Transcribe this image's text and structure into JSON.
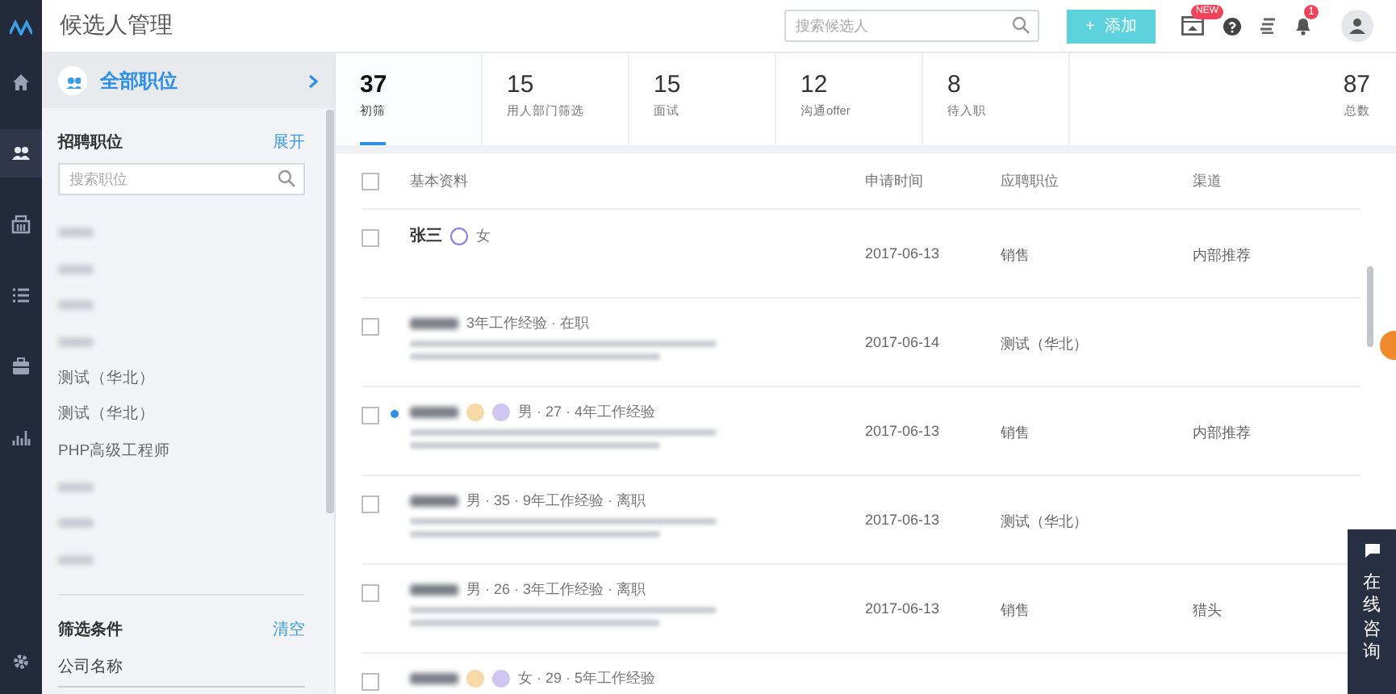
{
  "header": {
    "title": "候选人管理",
    "search": {
      "placeholder": "搜索候选人"
    },
    "add_button": {
      "icon": "+",
      "label": "添加"
    },
    "new_badge": "NEW",
    "notification_count": "1"
  },
  "nav": [
    {
      "kind": "home",
      "selected": false
    },
    {
      "kind": "people",
      "selected": true
    },
    {
      "kind": "building",
      "selected": false
    },
    {
      "kind": "list",
      "selected": false
    },
    {
      "kind": "case",
      "selected": false
    },
    {
      "kind": "chart",
      "selected": false
    }
  ],
  "sidebar": {
    "all_jobs": "全部职位",
    "section": "招聘职位",
    "expand": "展开",
    "search": {
      "placeholder": "搜索职位"
    },
    "jobs": [
      {
        "blurred": true
      },
      {
        "blurred": true
      },
      {
        "blurred": true
      },
      {
        "blurred": true
      },
      {
        "label": "测试（华北）",
        "blurred": false
      },
      {
        "label": "测试（华北）",
        "blurred": false
      },
      {
        "label": "PHP高级工程师",
        "blurred": false
      },
      {
        "blurred": true
      },
      {
        "blurred": true
      },
      {
        "blurred": true
      }
    ],
    "filter": "筛选条件",
    "clear": "清空",
    "company": "公司名称"
  },
  "stages": [
    {
      "count": "37",
      "label": "初筛",
      "selected": true
    },
    {
      "count": "15",
      "label": "用人部门筛选",
      "selected": false
    },
    {
      "count": "15",
      "label": "面试",
      "selected": false
    },
    {
      "count": "12",
      "label": "沟通offer",
      "selected": false
    },
    {
      "count": "8",
      "label": "待入职",
      "selected": false
    }
  ],
  "total": {
    "count": "87",
    "label": "总数"
  },
  "table": {
    "select_all_checked": false,
    "columns": [
      "基本资料",
      "申请时间",
      "应聘职位",
      "渠道"
    ],
    "rows": [
      {
        "checked": false,
        "unread": false,
        "name": "张三",
        "tags": [
          {
            "kind": "ring",
            "color": "#8a7be0"
          }
        ],
        "meta": "女",
        "details": [],
        "date": "2017-06-13",
        "position": "销售",
        "channel": "内部推荐"
      },
      {
        "checked": false,
        "unread": false,
        "tags": [],
        "meta": "3年工作经验 · 在职",
        "details": [
          {
            "kind": "blurred"
          },
          {
            "kind": "blurred"
          }
        ],
        "date": "2017-06-14",
        "position": "测试（华北）"
      },
      {
        "checked": false,
        "unread": true,
        "tags": [
          {
            "kind": "dot",
            "color": "#f6d9a8"
          },
          {
            "kind": "dot",
            "color": "#cfc6f2"
          }
        ],
        "meta": "男 · 27 · 4年工作经验",
        "details": [
          {
            "kind": "blurred"
          },
          {
            "kind": "blurred"
          }
        ],
        "date": "2017-06-13",
        "position": "销售",
        "channel": "内部推荐"
      },
      {
        "checked": false,
        "unread": false,
        "tags": [],
        "meta": "男 · 35 · 9年工作经验 · 离职",
        "details": [
          {
            "kind": "blurred"
          },
          {
            "kind": "blurred"
          }
        ],
        "date": "2017-06-13",
        "position": "测试（华北）"
      },
      {
        "checked": false,
        "unread": false,
        "tags": [],
        "meta": "男 · 26 · 3年工作经验 · 离职",
        "details": [
          {
            "kind": "blurred"
          },
          {
            "kind": "blurred"
          }
        ],
        "date": "2017-06-13",
        "position": "销售",
        "channel": "猎头"
      },
      {
        "checked": false,
        "unread": false,
        "tags": [
          {
            "kind": "dot",
            "color": "#f6d9a8"
          },
          {
            "kind": "dot",
            "color": "#cfc6f2"
          }
        ],
        "meta": "女 · 29 · 5年工作经验",
        "details": []
      }
    ]
  },
  "chat": {
    "label": "在线咨询"
  }
}
